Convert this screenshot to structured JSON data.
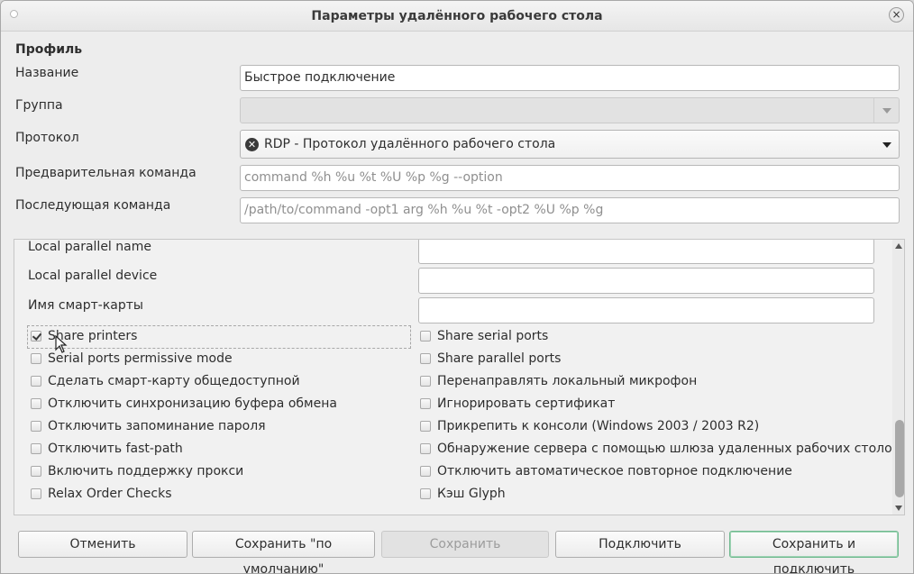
{
  "window": {
    "title": "Параметры удалённого рабочего стола",
    "close_glyph": "×"
  },
  "profile": {
    "heading": "Профиль",
    "name_label": "Название",
    "name_value": "Быстрое подключение",
    "group_label": "Группа",
    "group_value": "",
    "protocol_label": "Протокол",
    "protocol_value": "RDP - Протокол удалённого рабочего стола",
    "pre_command_label": "Предварительная команда",
    "pre_command_placeholder": "command %h %u %t %U %p %g --option",
    "post_command_label": "Последующая команда",
    "post_command_placeholder": "/path/to/command -opt1 arg %h %u %t -opt2 %U %p %g"
  },
  "advanced": {
    "local_parallel_name_label": "Local parallel name",
    "local_parallel_device_label": "Local parallel device",
    "smartcard_name_label": "Имя смарт-карты",
    "checks_left": [
      {
        "label": "Share printers",
        "checked": true
      },
      {
        "label": "Serial ports permissive mode",
        "checked": false
      },
      {
        "label": "Сделать смарт-карту общедоступной",
        "checked": false
      },
      {
        "label": "Отключить синхронизацию буфера обмена",
        "checked": false
      },
      {
        "label": "Отключить запоминание пароля",
        "checked": false
      },
      {
        "label": "Отключить fast-path",
        "checked": false
      },
      {
        "label": "Включить поддержку прокси",
        "checked": false
      },
      {
        "label": "Relax Order Checks",
        "checked": false
      }
    ],
    "checks_right": [
      {
        "label": "Share serial ports",
        "checked": false
      },
      {
        "label": "Share parallel ports",
        "checked": false
      },
      {
        "label": "Перенаправлять локальный микрофон",
        "checked": false
      },
      {
        "label": "Игнорировать сертификат",
        "checked": false
      },
      {
        "label": "Прикрепить к консоли (Windows 2003 / 2003 R2)",
        "checked": false
      },
      {
        "label": "Обнаружение сервера с помощью шлюза удаленных рабочих столов",
        "checked": false
      },
      {
        "label": "Отключить автоматическое повторное подключение",
        "checked": false
      },
      {
        "label": "Кэш Glyph",
        "checked": false
      }
    ]
  },
  "buttons": {
    "cancel": "Отменить",
    "save_default": "Сохранить \"по умолчанию\"",
    "save": "Сохранить",
    "connect": "Подключить",
    "save_connect": "Сохранить и подключить"
  },
  "colors": {
    "accent_default_button": "#6fb98f",
    "window_bg": "#ededed"
  }
}
